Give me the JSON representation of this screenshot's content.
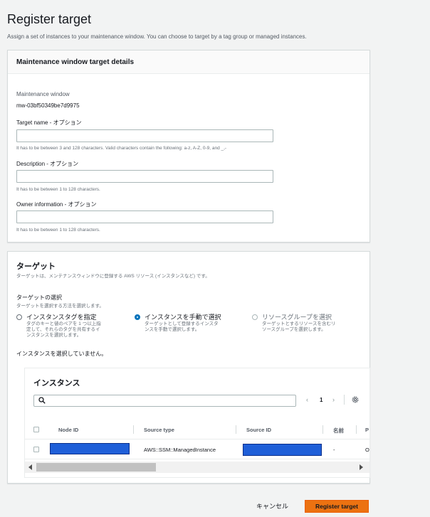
{
  "header": {
    "title": "Register target",
    "subtitle": "Assign a set of instances to your maintenance window. You can choose to target by a tag group or managed instances."
  },
  "details": {
    "heading": "Maintenance window target details",
    "window_label": "Maintenance window",
    "window_id": "mw-03bf50349be7d9975",
    "target_name_label": "Target name - オプション",
    "target_name_value": "",
    "target_name_hint": "It has to be between 3 and 128 characters. Valid characters contain the following: a-z, A-Z, 0-9, and _,-",
    "description_label": "Description - オプション",
    "description_value": "",
    "description_hint": "It has to be between 1 to 128 characters.",
    "owner_label": "Owner information - オプション",
    "owner_value": "",
    "owner_hint": "It has to be between 1 to 128 characters."
  },
  "targets": {
    "title": "ターゲット",
    "description": "ターゲットは、メンテナンスウィンドウに登録する AWS リソース (インスタンスなど) です。",
    "select_label": "ターゲットの選択",
    "select_desc": "ターゲットを選択する方法を選択します。",
    "options": [
      {
        "label": "インスタンスタグを指定",
        "desc": "タグのキーと値のペアを 1 つ以上指\n定して、それらのタグを共有するイ\nンスタンスを選択します。",
        "selected": false
      },
      {
        "label": "インスタンスを手動で選択",
        "desc": "ターゲットとして登録するインスタ\nンスを手動で選択します。",
        "selected": true
      },
      {
        "label": "リソースグループを選択",
        "desc": "ターゲットとするリソースを含むリ\nソースグループを選択します。",
        "selected": false
      }
    ],
    "no_selection": "インスタンスを選択していません。"
  },
  "instances": {
    "title": "インスタンス",
    "search_value": "",
    "page": "1",
    "columns": [
      "Node ID",
      "Source type",
      "Source ID",
      "名前",
      "P"
    ],
    "rows": [
      {
        "node_id": "",
        "source_type": "AWS::SSM::ManagedInstance",
        "source_id": "",
        "name": "-",
        "p": "O"
      }
    ]
  },
  "footer": {
    "cancel": "キャンセル",
    "submit": "Register target"
  },
  "colors": {
    "accent": "#ec7211",
    "radio_selected": "#0073bb",
    "redaction": "#1f5fd8"
  }
}
